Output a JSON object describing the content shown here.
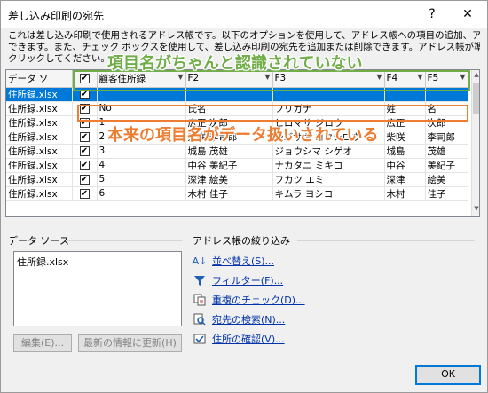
{
  "window": {
    "title": "差し込み印刷の宛先",
    "help_label": "?",
    "close_label": "✕"
  },
  "description": [
    "これは差し込み印刷で使用されるアドレス帳です。以下のオプションを使用して、アドレス帳への項目の追加、アドレス帳の変更が",
    "できます。また、チェック ボックスを使用して、差し込み印刷の宛先を追加または削除できます。アドレス帳が準備できたら [OK] を",
    "クリックしてください。"
  ],
  "grid": {
    "columns": [
      "データ ソ",
      "",
      "顧客住所録",
      "F2",
      "F3",
      "F4",
      "F5"
    ],
    "rows": [
      {
        "source": "住所録.xlsx",
        "checked": true,
        "cells": [
          "",
          "",
          "",
          "",
          ""
        ],
        "selected": true
      },
      {
        "source": "住所録.xlsx",
        "checked": true,
        "cells": [
          "No",
          "氏名",
          "フリガナ",
          "姓",
          "名"
        ]
      },
      {
        "source": "住所録.xlsx",
        "checked": true,
        "cells": [
          "1",
          "広正 次郎",
          "ヒロマサ ジロウ",
          "広正",
          "次郎"
        ]
      },
      {
        "source": "住所録.xlsx",
        "checked": true,
        "cells": [
          "2",
          "柴咲 李司郎",
          "シバサキ コウシロウ",
          "柴咲",
          "李司郎"
        ]
      },
      {
        "source": "住所録.xlsx",
        "checked": true,
        "cells": [
          "3",
          "城島 茂雄",
          "ジョウシマ シゲオ",
          "城島",
          "茂雄"
        ]
      },
      {
        "source": "住所録.xlsx",
        "checked": true,
        "cells": [
          "4",
          "中谷 美紀子",
          "ナカタニ ミキコ",
          "中谷",
          "美紀子"
        ]
      },
      {
        "source": "住所録.xlsx",
        "checked": true,
        "cells": [
          "5",
          "深津 絵美",
          "フカツ エミ",
          "深津",
          "絵美"
        ]
      },
      {
        "source": "住所録.xlsx",
        "checked": true,
        "cells": [
          "6",
          "木村 佳子",
          "キムラ ヨシコ",
          "木村",
          "佳子"
        ]
      }
    ]
  },
  "annotations": {
    "top": "項目名がちゃんと認識されていない",
    "middle": "本来の項目名がデータ扱いされている"
  },
  "data_source": {
    "label": "データ ソース",
    "items": [
      "住所録.xlsx"
    ],
    "edit_button": "編集(E)...",
    "refresh_button": "最新の情報に更新(H)"
  },
  "refine": {
    "label": "アドレス帳の絞り込み",
    "links": [
      {
        "label": "並べ替え(S)...",
        "icon": "sort-icon"
      },
      {
        "label": "フィルター(F)...",
        "icon": "filter-icon"
      },
      {
        "label": "重複のチェック(D)...",
        "icon": "duplicate-icon"
      },
      {
        "label": "宛先の検索(N)...",
        "icon": "find-recipient-icon"
      },
      {
        "label": "住所の確認(V)...",
        "icon": "validate-address-icon"
      }
    ]
  },
  "ok_button": "OK",
  "colors": {
    "selection": "#0078d7",
    "annotation_green": "#70ad47",
    "annotation_orange": "#ed7d31",
    "link": "#0033aa"
  }
}
